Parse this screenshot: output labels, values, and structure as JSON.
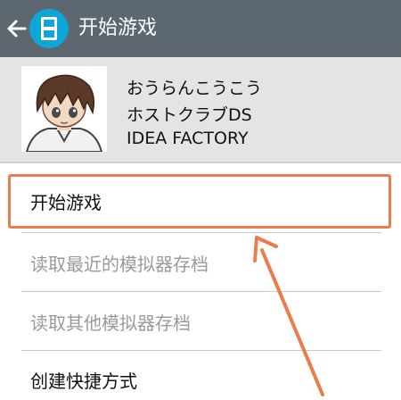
{
  "header": {
    "title": "开始游戏",
    "back_icon": "back-arrow-icon",
    "app_icon": "nintendo-ds-emulator-icon",
    "bar_color": "#5c6770",
    "app_icon_color": "#0fa5d8"
  },
  "game": {
    "title_jp": "おうらんこうこう",
    "subtitle": "ホストクラブDS",
    "publisher": "IDEA FACTORY",
    "cover_icon": "anime-character-avatar"
  },
  "menu": {
    "items": [
      {
        "label": "开始游戏",
        "enabled": true,
        "highlighted": true
      },
      {
        "label": "读取最近的模拟器存档",
        "enabled": false
      },
      {
        "label": "读取其他模拟器存档",
        "enabled": false
      },
      {
        "label": "创建快捷方式",
        "enabled": true
      }
    ]
  },
  "annotation": {
    "highlight_color": "#ea7d4c",
    "arrow_icon": "pointer-arrow-icon"
  }
}
